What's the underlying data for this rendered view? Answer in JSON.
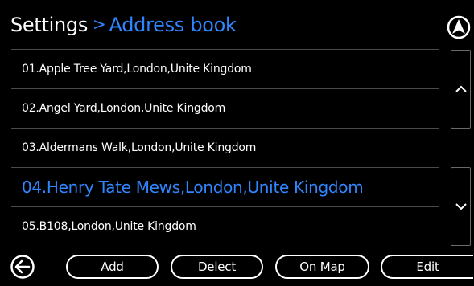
{
  "header": {
    "title": "Settings",
    "separator": ">",
    "current": "Address book"
  },
  "icons": {
    "navigation": "navigation-arrow-icon",
    "scroll_up": "chevron-up-icon",
    "scroll_down": "chevron-down-icon",
    "back": "back-arrow-icon"
  },
  "addresses": [
    "01.Apple Tree Yard,London,Unite Kingdom",
    "02.Angel Yard,London,Unite Kingdom",
    "03.Aldermans Walk,London,Unite Kingdom",
    "04.Henry Tate Mews,London,Unite Kingdom",
    "05.B108,London,Unite Kingdom"
  ],
  "selected_index": 3,
  "toolbar": {
    "add": "Add",
    "delect": "Delect",
    "on_map": "On Map",
    "edit": "Edit"
  },
  "colors": {
    "accent": "#2f86ff",
    "background": "#000000",
    "text": "#ffffff",
    "divider": "#4a4a4a"
  }
}
